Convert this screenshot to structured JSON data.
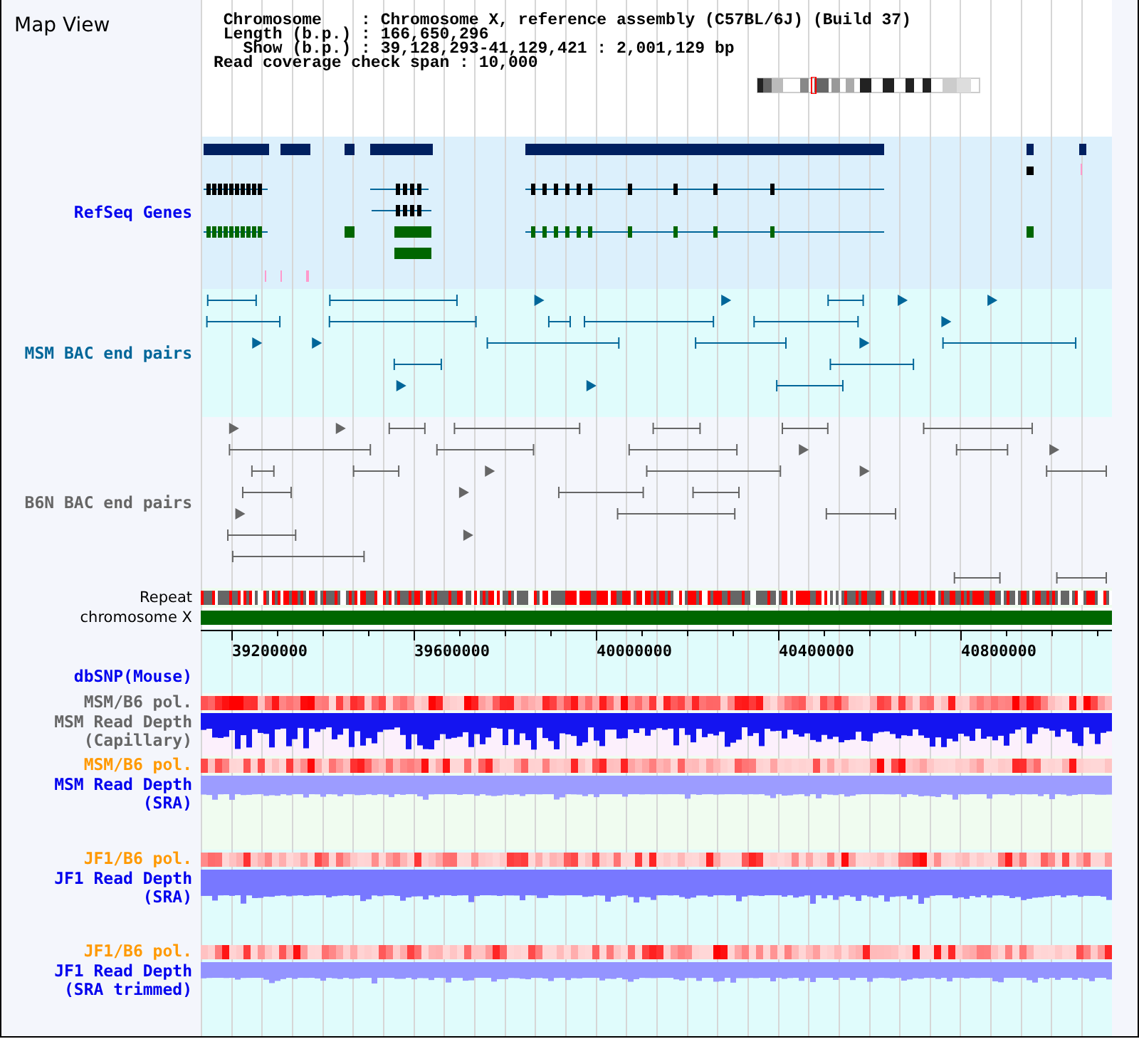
{
  "title": "Map View",
  "info_lines": [
    " Chromosome    : Chromosome X, reference assembly (C57BL/6J) (Build 37)",
    " Length (b.p.) : 166,650,296",
    "   Show (b.p.) : 39,128,293-41,129,421 : 2,001,129 bp",
    "Read coverage check span : 10,000"
  ],
  "tracks": [
    {
      "label": "RefSeq Genes",
      "color": "#0000ee",
      "kind": "genes"
    },
    {
      "label": "MSM BAC end pairs",
      "color": "#006699",
      "kind": "bac"
    },
    {
      "label": "B6N BAC end pairs",
      "color": "#666666",
      "kind": "bac"
    },
    {
      "label": "Repeat",
      "color": "#000000",
      "kind": "repeat"
    },
    {
      "label": "chromosome X",
      "color": "#000000",
      "kind": "chromosome"
    },
    {
      "kind": "axis",
      "ticks": [
        "39200000",
        "39600000",
        "40000000",
        "40400000",
        "40800000"
      ]
    },
    {
      "label": "dbSNP(Mouse)",
      "color": "#0000ee",
      "kind": "snp"
    },
    {
      "label": "MSM/B6 pol.",
      "color": "#666666",
      "kind": "pol"
    },
    {
      "label": "MSM Read Depth (Capillary)",
      "color": "#666666",
      "kind": "depth"
    },
    {
      "label": "MSM/B6 pol.",
      "color": "#ff9900",
      "kind": "pol"
    },
    {
      "label": "MSM Read Depth (SRA)",
      "color": "#0000ee",
      "kind": "depth"
    },
    {
      "label": "JF1/B6 pol.",
      "color": "#ff9900",
      "kind": "pol"
    },
    {
      "label": "JF1 Read Depth (SRA)",
      "color": "#0000ee",
      "kind": "depth"
    },
    {
      "label": "JF1/B6 pol.",
      "color": "#ff9900",
      "kind": "pol"
    },
    {
      "label": "JF1 Read Depth (SRA trimmed)",
      "color": "#0000ee",
      "kind": "depth"
    }
  ]
}
